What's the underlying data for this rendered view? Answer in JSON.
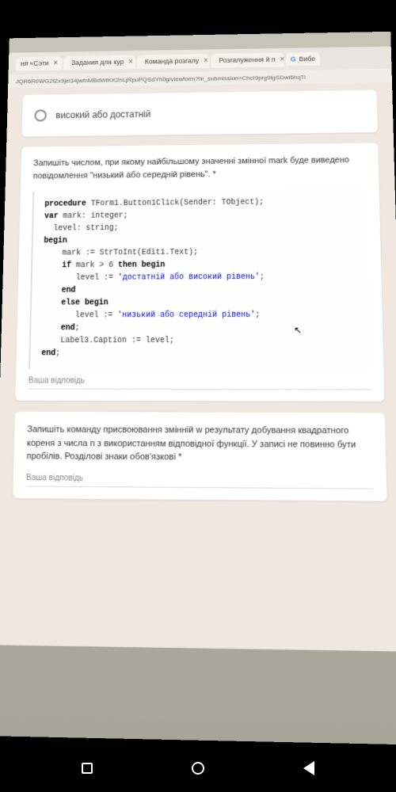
{
  "tabs": [
    {
      "label": "ня «Сэти",
      "icon": ""
    },
    {
      "label": "Задания для кур",
      "icon": "blue"
    },
    {
      "label": "Команда розгалу",
      "icon": "purple"
    },
    {
      "label": "Розгалуження й п",
      "icon": "multi"
    },
    {
      "label": "Вибе",
      "icon": "G"
    }
  ],
  "url": "JQR6R0WG2fZx9jel34jwfnMBdWtKK2hLjRpuPQSdYh0g/viewform?hr_submission=ChcI9prg9IgSDwi6hqTi",
  "radio_option": "високий або достатній",
  "question1": {
    "text": "Запишіть числом, при якому найбільшому значенні змінної mark буде виведено повідомлення \"низький або середній рівень\". *",
    "code_lines": {
      "l1a": "procedure",
      "l1b": " TForm1.Button1Click(Sender: TObject);",
      "l2a": "var",
      "l2b": " mark: integer;",
      "l3": "  level: string;",
      "l4": "begin",
      "l5": "    mark := StrToInt(Edit1.Text);",
      "l6a": "    ",
      "l6b": "if",
      "l6c": " mark > 6 ",
      "l6d": "then begin",
      "l7a": "       level := ",
      "l7b": "'достатній або високий рівень'",
      "l7c": ";",
      "l8": "    end",
      "l9a": "    ",
      "l9b": "else begin",
      "l10a": "       level := ",
      "l10b": "'низький або середній рівень'",
      "l10c": ";",
      "l11a": "    ",
      "l11b": "end",
      "l11c": ";",
      "l12": "    Label3.Caption := level;",
      "l13a": "end",
      "l13b": ";"
    },
    "answer_placeholder": "Ваша відповідь"
  },
  "question2": {
    "text": "Запишіть команду присвоювання змінній w результату добування квадратного кореня з числа n з використанням відповідної функції. У записі не повинно бути пробілів. Розділові знаки обов'язкові *",
    "answer_placeholder": "Ваша відповідь"
  }
}
